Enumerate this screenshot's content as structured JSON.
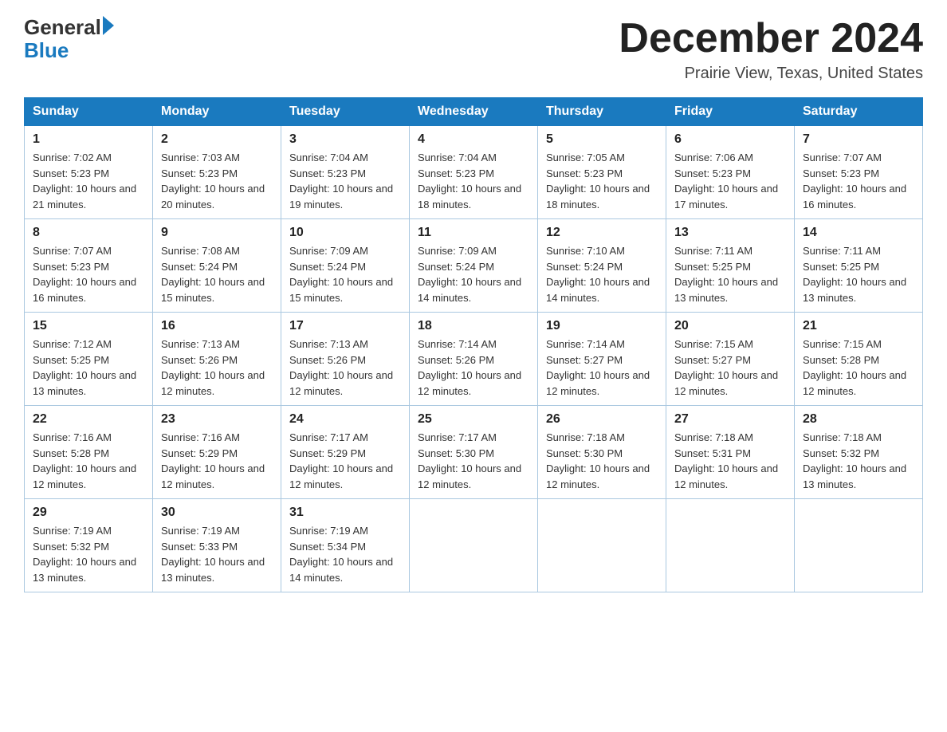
{
  "header": {
    "logo_general": "General",
    "logo_blue": "Blue",
    "title": "December 2024",
    "subtitle": "Prairie View, Texas, United States"
  },
  "weekdays": [
    "Sunday",
    "Monday",
    "Tuesday",
    "Wednesday",
    "Thursday",
    "Friday",
    "Saturday"
  ],
  "weeks": [
    [
      {
        "day": "1",
        "sunrise": "7:02 AM",
        "sunset": "5:23 PM",
        "daylight": "10 hours and 21 minutes."
      },
      {
        "day": "2",
        "sunrise": "7:03 AM",
        "sunset": "5:23 PM",
        "daylight": "10 hours and 20 minutes."
      },
      {
        "day": "3",
        "sunrise": "7:04 AM",
        "sunset": "5:23 PM",
        "daylight": "10 hours and 19 minutes."
      },
      {
        "day": "4",
        "sunrise": "7:04 AM",
        "sunset": "5:23 PM",
        "daylight": "10 hours and 18 minutes."
      },
      {
        "day": "5",
        "sunrise": "7:05 AM",
        "sunset": "5:23 PM",
        "daylight": "10 hours and 18 minutes."
      },
      {
        "day": "6",
        "sunrise": "7:06 AM",
        "sunset": "5:23 PM",
        "daylight": "10 hours and 17 minutes."
      },
      {
        "day": "7",
        "sunrise": "7:07 AM",
        "sunset": "5:23 PM",
        "daylight": "10 hours and 16 minutes."
      }
    ],
    [
      {
        "day": "8",
        "sunrise": "7:07 AM",
        "sunset": "5:23 PM",
        "daylight": "10 hours and 16 minutes."
      },
      {
        "day": "9",
        "sunrise": "7:08 AM",
        "sunset": "5:24 PM",
        "daylight": "10 hours and 15 minutes."
      },
      {
        "day": "10",
        "sunrise": "7:09 AM",
        "sunset": "5:24 PM",
        "daylight": "10 hours and 15 minutes."
      },
      {
        "day": "11",
        "sunrise": "7:09 AM",
        "sunset": "5:24 PM",
        "daylight": "10 hours and 14 minutes."
      },
      {
        "day": "12",
        "sunrise": "7:10 AM",
        "sunset": "5:24 PM",
        "daylight": "10 hours and 14 minutes."
      },
      {
        "day": "13",
        "sunrise": "7:11 AM",
        "sunset": "5:25 PM",
        "daylight": "10 hours and 13 minutes."
      },
      {
        "day": "14",
        "sunrise": "7:11 AM",
        "sunset": "5:25 PM",
        "daylight": "10 hours and 13 minutes."
      }
    ],
    [
      {
        "day": "15",
        "sunrise": "7:12 AM",
        "sunset": "5:25 PM",
        "daylight": "10 hours and 13 minutes."
      },
      {
        "day": "16",
        "sunrise": "7:13 AM",
        "sunset": "5:26 PM",
        "daylight": "10 hours and 12 minutes."
      },
      {
        "day": "17",
        "sunrise": "7:13 AM",
        "sunset": "5:26 PM",
        "daylight": "10 hours and 12 minutes."
      },
      {
        "day": "18",
        "sunrise": "7:14 AM",
        "sunset": "5:26 PM",
        "daylight": "10 hours and 12 minutes."
      },
      {
        "day": "19",
        "sunrise": "7:14 AM",
        "sunset": "5:27 PM",
        "daylight": "10 hours and 12 minutes."
      },
      {
        "day": "20",
        "sunrise": "7:15 AM",
        "sunset": "5:27 PM",
        "daylight": "10 hours and 12 minutes."
      },
      {
        "day": "21",
        "sunrise": "7:15 AM",
        "sunset": "5:28 PM",
        "daylight": "10 hours and 12 minutes."
      }
    ],
    [
      {
        "day": "22",
        "sunrise": "7:16 AM",
        "sunset": "5:28 PM",
        "daylight": "10 hours and 12 minutes."
      },
      {
        "day": "23",
        "sunrise": "7:16 AM",
        "sunset": "5:29 PM",
        "daylight": "10 hours and 12 minutes."
      },
      {
        "day": "24",
        "sunrise": "7:17 AM",
        "sunset": "5:29 PM",
        "daylight": "10 hours and 12 minutes."
      },
      {
        "day": "25",
        "sunrise": "7:17 AM",
        "sunset": "5:30 PM",
        "daylight": "10 hours and 12 minutes."
      },
      {
        "day": "26",
        "sunrise": "7:18 AM",
        "sunset": "5:30 PM",
        "daylight": "10 hours and 12 minutes."
      },
      {
        "day": "27",
        "sunrise": "7:18 AM",
        "sunset": "5:31 PM",
        "daylight": "10 hours and 12 minutes."
      },
      {
        "day": "28",
        "sunrise": "7:18 AM",
        "sunset": "5:32 PM",
        "daylight": "10 hours and 13 minutes."
      }
    ],
    [
      {
        "day": "29",
        "sunrise": "7:19 AM",
        "sunset": "5:32 PM",
        "daylight": "10 hours and 13 minutes."
      },
      {
        "day": "30",
        "sunrise": "7:19 AM",
        "sunset": "5:33 PM",
        "daylight": "10 hours and 13 minutes."
      },
      {
        "day": "31",
        "sunrise": "7:19 AM",
        "sunset": "5:34 PM",
        "daylight": "10 hours and 14 minutes."
      },
      null,
      null,
      null,
      null
    ]
  ],
  "labels": {
    "sunrise": "Sunrise:",
    "sunset": "Sunset:",
    "daylight": "Daylight:"
  }
}
